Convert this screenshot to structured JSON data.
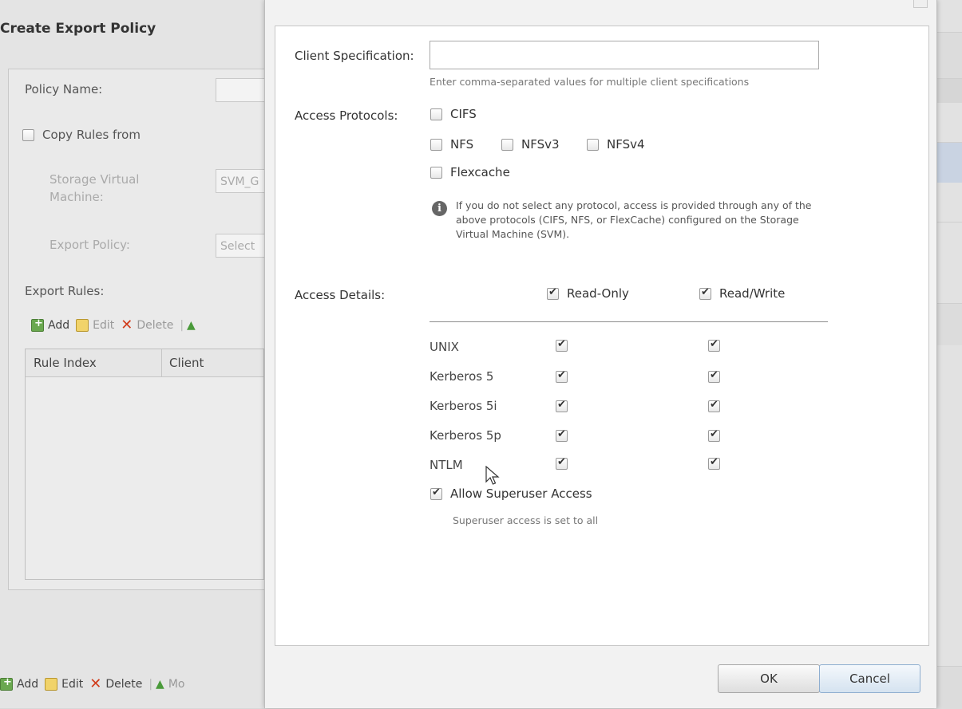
{
  "background_window": {
    "title": "Create Export Policy",
    "policy_name_label": "Policy Name:",
    "copy_rules_label": "Copy Rules from",
    "svm_label": "Storage Virtual Machine:",
    "svm_value": "SVM_G",
    "export_policy_label": "Export Policy:",
    "export_policy_value": "Select",
    "export_rules_label": "Export Rules:",
    "toolbar": {
      "add": "Add",
      "edit": "Edit",
      "delete": "Delete"
    },
    "table_headers": [
      "Rule Index",
      "Client"
    ],
    "bottom_toolbar": {
      "add": "Add",
      "edit": "Edit",
      "delete": "Delete",
      "move": "Mo"
    }
  },
  "dialog": {
    "client_spec_label": "Client Specification:",
    "client_spec_value": "",
    "client_spec_hint": "Enter comma-separated values for multiple client specifications",
    "access_protocols_label": "Access Protocols:",
    "protocols": {
      "cifs": {
        "label": "CIFS",
        "checked": false
      },
      "nfs": {
        "label": "NFS",
        "checked": false
      },
      "nfsv3": {
        "label": "NFSv3",
        "checked": false
      },
      "nfsv4": {
        "label": "NFSv4",
        "checked": false
      },
      "flexcache": {
        "label": "Flexcache",
        "checked": false
      }
    },
    "protocol_info": "If you do not select any protocol, access is provided through any of the above protocols (CIFS, NFS, or FlexCache) configured on the Storage Virtual Machine (SVM).",
    "access_details_label": "Access Details:",
    "read_only_label": "Read-Only",
    "read_write_label": "Read/Write",
    "rows": [
      {
        "label": "UNIX",
        "read_only": true,
        "read_write": true
      },
      {
        "label": "Kerberos 5",
        "read_only": true,
        "read_write": true
      },
      {
        "label": "Kerberos 5i",
        "read_only": true,
        "read_write": true
      },
      {
        "label": "Kerberos 5p",
        "read_only": true,
        "read_write": true
      },
      {
        "label": "NTLM",
        "read_only": true,
        "read_write": true
      }
    ],
    "superuser_label": "Allow Superuser Access",
    "superuser_checked": true,
    "superuser_hint": "Superuser access is set to all",
    "ok_label": "OK",
    "cancel_label": "Cancel"
  }
}
